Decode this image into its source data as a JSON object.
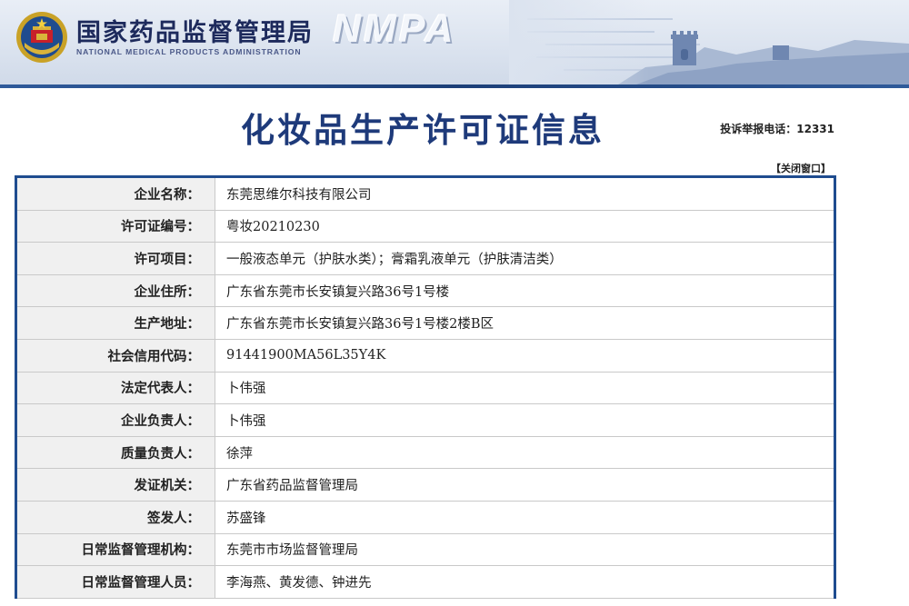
{
  "header": {
    "brand_cn": "国家药品监督管理局",
    "brand_en": "NATIONAL MEDICAL PRODUCTS ADMINISTRATION",
    "brand_abbr": "NMPA",
    "emblem_icon": "national-emblem-icon",
    "banner_art": "great-wall-illustration",
    "colors": {
      "banner_bg": "#dbe3ef",
      "banner_bar": "#1c3f78",
      "brand_text": "#1d2a5c"
    }
  },
  "page": {
    "title": "化妆品生产许可证信息",
    "hotline": "投诉举报电话：12331",
    "close_label": "【关闭窗口】",
    "colors": {
      "title": "#1e3a7a",
      "table_border": "#1f4c8f",
      "label_bg": "#f0f0f0"
    }
  },
  "info": {
    "rows": [
      {
        "label": "企业名称：",
        "value": "东莞思维尔科技有限公司"
      },
      {
        "label": "许可证编号：",
        "value": "粤妆20210230"
      },
      {
        "label": "许可项目：",
        "value": "一般液态单元（护肤水类）；膏霜乳液单元（护肤清洁类）"
      },
      {
        "label": "企业住所：",
        "value": "广东省东莞市长安镇复兴路36号1号楼"
      },
      {
        "label": "生产地址：",
        "value": "广东省东莞市长安镇复兴路36号1号楼2楼B区"
      },
      {
        "label": "社会信用代码：",
        "value": "91441900MA56L35Y4K"
      },
      {
        "label": "法定代表人：",
        "value": "卜伟强"
      },
      {
        "label": "企业负责人：",
        "value": "卜伟强"
      },
      {
        "label": "质量负责人：",
        "value": "徐萍"
      },
      {
        "label": "发证机关：",
        "value": "广东省药品监督管理局"
      },
      {
        "label": "签发人：",
        "value": "苏盛锋"
      },
      {
        "label": "日常监督管理机构：",
        "value": "东莞市市场监督管理局"
      },
      {
        "label": "日常监督管理人员：",
        "value": "李海燕、黄发德、钟进先"
      }
    ]
  }
}
